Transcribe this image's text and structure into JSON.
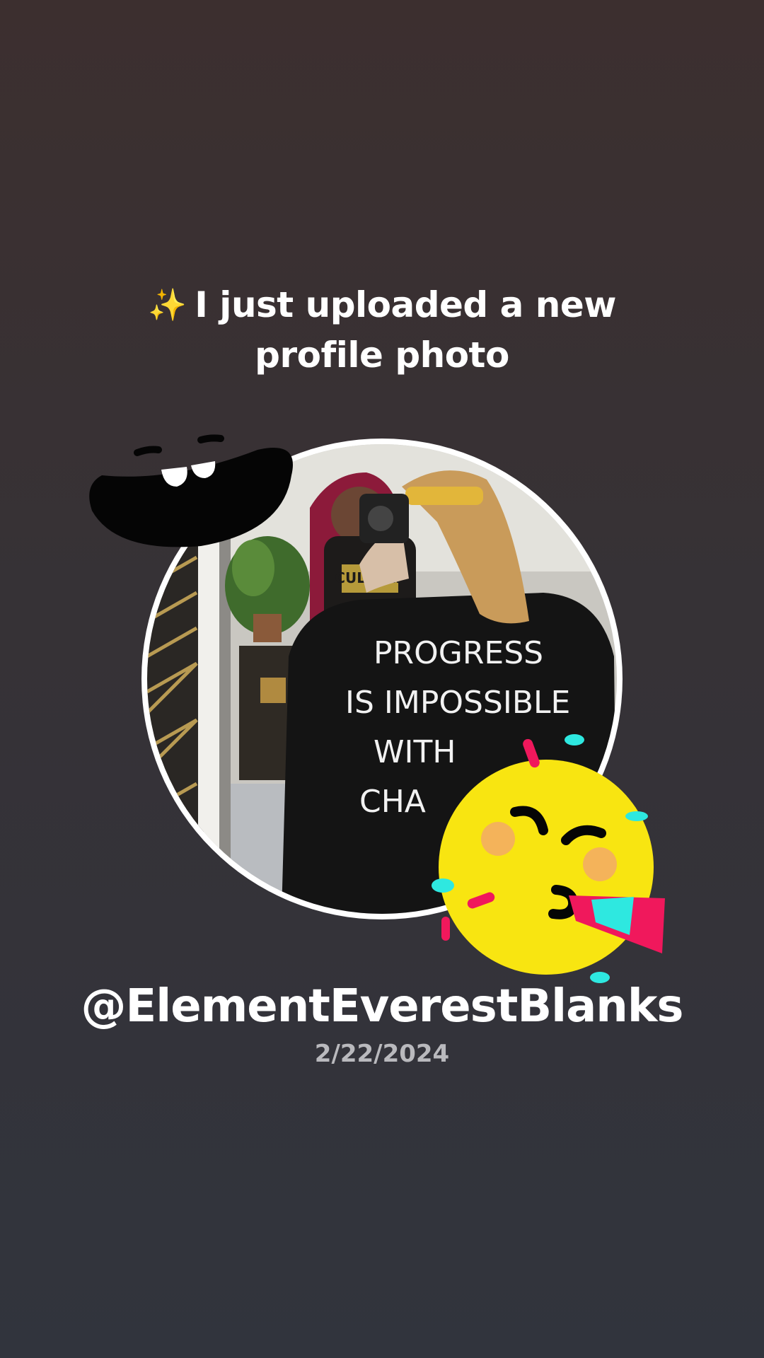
{
  "headline": {
    "icon": "sparkles-icon",
    "text_line1": "I just uploaded a new",
    "text_line2": "profile photo"
  },
  "profile_photo": {
    "shirt_text": [
      "PROGRESS",
      "IS IMPOSSIBLE",
      "WITH",
      "CHA"
    ],
    "shirt_logo_text": "CULTURE"
  },
  "stickers": [
    "laughing-mouth-sticker",
    "party-face-sticker"
  ],
  "user": {
    "handle": "@ElementEverestBlanks",
    "date": "2/22/2024"
  },
  "colors": {
    "background_top": "#3c2f2f",
    "background_bottom": "#31343d",
    "ring": "#ffffff",
    "party_yellow": "#f8e511",
    "party_pink": "#f0185c",
    "party_cyan": "#2ee8e0"
  }
}
